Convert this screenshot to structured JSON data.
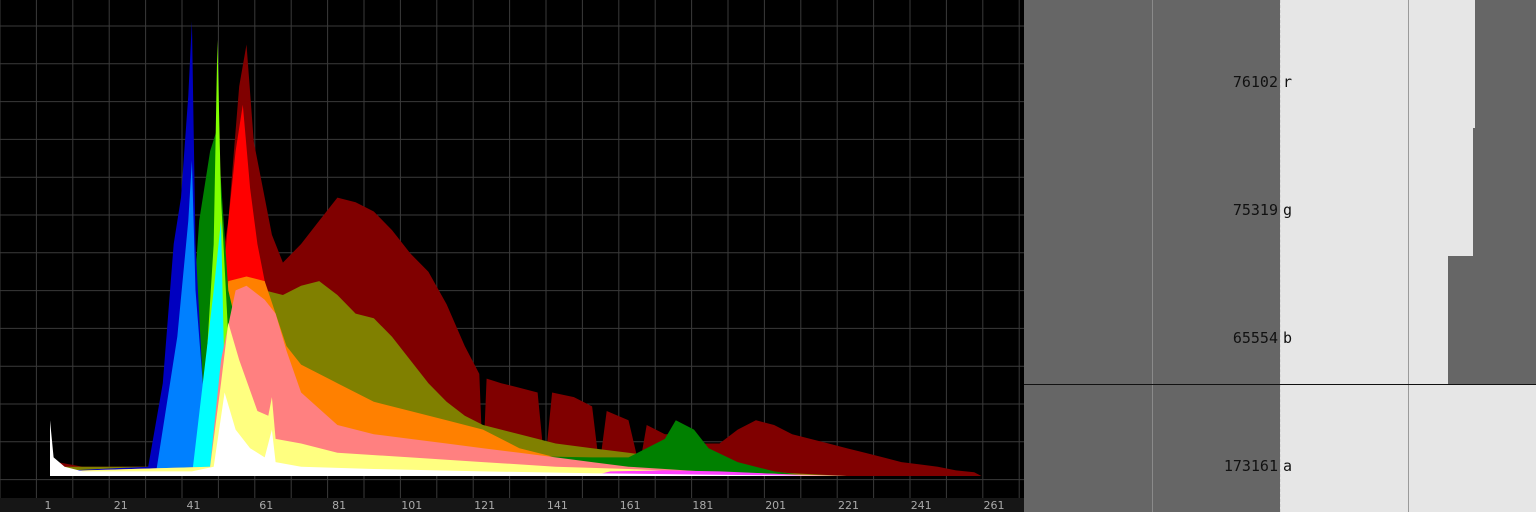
{
  "chart_data": {
    "type": "area",
    "x_ticks": [
      "1",
      "21",
      "41",
      "61",
      "81",
      "101",
      "121",
      "141",
      "161",
      "181",
      "201",
      "221",
      "241",
      "261"
    ],
    "xlim": [
      1,
      261
    ],
    "grid": true,
    "series": [
      {
        "color": "#800000",
        "points": [
          [
            1,
            0.05
          ],
          [
            3,
            0.03
          ],
          [
            10,
            0.02
          ],
          [
            20,
            0.02
          ],
          [
            30,
            0.02
          ],
          [
            40,
            0.1
          ],
          [
            45,
            0.3
          ],
          [
            50,
            0.55
          ],
          [
            53,
            0.84
          ],
          [
            55,
            0.93
          ],
          [
            57,
            0.72
          ],
          [
            60,
            0.6
          ],
          [
            62,
            0.52
          ],
          [
            65,
            0.46
          ],
          [
            70,
            0.5
          ],
          [
            75,
            0.55
          ],
          [
            80,
            0.6
          ],
          [
            85,
            0.59
          ],
          [
            90,
            0.57
          ],
          [
            95,
            0.53
          ],
          [
            100,
            0.48
          ],
          [
            105,
            0.44
          ],
          [
            110,
            0.37
          ],
          [
            115,
            0.28
          ],
          [
            119,
            0.22
          ],
          [
            120,
            0.02
          ],
          [
            121,
            0.21
          ],
          [
            125,
            0.2
          ],
          [
            130,
            0.19
          ],
          [
            135,
            0.18
          ],
          [
            137,
            0.02
          ],
          [
            139,
            0.18
          ],
          [
            145,
            0.17
          ],
          [
            150,
            0.15
          ],
          [
            152,
            0.02
          ],
          [
            154,
            0.14
          ],
          [
            160,
            0.12
          ],
          [
            163,
            0.02
          ],
          [
            165,
            0.11
          ],
          [
            170,
            0.09
          ],
          [
            175,
            0.09
          ],
          [
            180,
            0.07
          ],
          [
            185,
            0.07
          ],
          [
            190,
            0.1
          ],
          [
            195,
            0.12
          ],
          [
            200,
            0.11
          ],
          [
            205,
            0.09
          ],
          [
            210,
            0.08
          ],
          [
            215,
            0.07
          ],
          [
            220,
            0.06
          ],
          [
            225,
            0.05
          ],
          [
            230,
            0.04
          ],
          [
            235,
            0.03
          ],
          [
            240,
            0.025
          ],
          [
            245,
            0.02
          ],
          [
            250,
            0.012
          ],
          [
            255,
            0.008
          ],
          [
            257,
            0
          ]
        ]
      },
      {
        "color": "#ff0000",
        "points": [
          [
            40,
            0
          ],
          [
            46,
            0.2
          ],
          [
            50,
            0.55
          ],
          [
            52,
            0.7
          ],
          [
            54,
            0.8
          ],
          [
            56,
            0.62
          ],
          [
            58,
            0.5
          ],
          [
            60,
            0.42
          ],
          [
            61,
            0
          ]
        ]
      },
      {
        "color": "#808000",
        "points": [
          [
            1,
            0.02
          ],
          [
            40,
            0.02
          ],
          [
            50,
            0.35
          ],
          [
            55,
            0.42
          ],
          [
            60,
            0.4
          ],
          [
            65,
            0.39
          ],
          [
            70,
            0.41
          ],
          [
            75,
            0.42
          ],
          [
            80,
            0.39
          ],
          [
            85,
            0.35
          ],
          [
            90,
            0.34
          ],
          [
            95,
            0.3
          ],
          [
            100,
            0.25
          ],
          [
            105,
            0.2
          ],
          [
            110,
            0.16
          ],
          [
            115,
            0.13
          ],
          [
            120,
            0.11
          ],
          [
            125,
            0.1
          ],
          [
            130,
            0.09
          ],
          [
            140,
            0.07
          ],
          [
            150,
            0.06
          ],
          [
            160,
            0.05
          ],
          [
            170,
            0.04
          ],
          [
            180,
            0.025
          ],
          [
            190,
            0.015
          ],
          [
            200,
            0.008
          ],
          [
            210,
            0.004
          ],
          [
            220,
            0
          ]
        ]
      },
      {
        "color": "#ff8000",
        "points": [
          [
            1,
            0.01
          ],
          [
            45,
            0.02
          ],
          [
            50,
            0.42
          ],
          [
            55,
            0.43
          ],
          [
            60,
            0.42
          ],
          [
            63,
            0.35
          ],
          [
            66,
            0.28
          ],
          [
            70,
            0.24
          ],
          [
            80,
            0.2
          ],
          [
            90,
            0.16
          ],
          [
            100,
            0.14
          ],
          [
            110,
            0.12
          ],
          [
            120,
            0.1
          ],
          [
            130,
            0.06
          ],
          [
            140,
            0.04
          ],
          [
            150,
            0.03
          ],
          [
            160,
            0
          ]
        ]
      },
      {
        "color": "#008000",
        "points": [
          [
            1,
            0.01
          ],
          [
            30,
            0.02
          ],
          [
            38,
            0.1
          ],
          [
            42,
            0.55
          ],
          [
            45,
            0.7
          ],
          [
            47,
            0.75
          ],
          [
            50,
            0.4
          ],
          [
            53,
            0.3
          ],
          [
            60,
            0.1
          ],
          [
            80,
            0.05
          ],
          [
            150,
            0.04
          ],
          [
            160,
            0.04
          ],
          [
            170,
            0.08
          ],
          [
            173,
            0.12
          ],
          [
            178,
            0.1
          ],
          [
            182,
            0.06
          ],
          [
            190,
            0.03
          ],
          [
            200,
            0.01
          ],
          [
            210,
            0
          ]
        ]
      },
      {
        "color": "#0000c0",
        "points": [
          [
            1,
            0.01
          ],
          [
            28,
            0.02
          ],
          [
            32,
            0.2
          ],
          [
            35,
            0.5
          ],
          [
            37,
            0.6
          ],
          [
            39,
            0.82
          ],
          [
            40,
            0.98
          ],
          [
            41,
            0.5
          ],
          [
            43,
            0.2
          ],
          [
            46,
            0.1
          ],
          [
            55,
            0.03
          ],
          [
            80,
            0.01
          ],
          [
            100,
            0
          ]
        ]
      },
      {
        "color": "#0080ff",
        "points": [
          [
            30,
            0
          ],
          [
            36,
            0.3
          ],
          [
            39,
            0.55
          ],
          [
            40,
            0.68
          ],
          [
            41,
            0.4
          ],
          [
            43,
            0.2
          ],
          [
            46,
            0.08
          ],
          [
            50,
            0
          ]
        ]
      },
      {
        "color": "#80ff00",
        "points": [
          [
            42,
            0
          ],
          [
            46,
            0.5
          ],
          [
            47,
            0.94
          ],
          [
            48,
            0.6
          ],
          [
            50,
            0.3
          ],
          [
            53,
            0.1
          ],
          [
            56,
            0
          ]
        ]
      },
      {
        "color": "#00ffff",
        "points": [
          [
            40,
            0
          ],
          [
            43,
            0.2
          ],
          [
            46,
            0.4
          ],
          [
            48,
            0.55
          ],
          [
            49,
            0.2
          ],
          [
            51,
            0.05
          ],
          [
            54,
            0
          ]
        ]
      },
      {
        "color": "#ff8080",
        "points": [
          [
            1,
            0.01
          ],
          [
            45,
            0.02
          ],
          [
            48,
            0.25
          ],
          [
            52,
            0.4
          ],
          [
            55,
            0.41
          ],
          [
            60,
            0.38
          ],
          [
            63,
            0.35
          ],
          [
            66,
            0.27
          ],
          [
            70,
            0.18
          ],
          [
            80,
            0.11
          ],
          [
            90,
            0.09
          ],
          [
            100,
            0.08
          ],
          [
            110,
            0.07
          ],
          [
            120,
            0.06
          ],
          [
            130,
            0.05
          ],
          [
            140,
            0.04
          ],
          [
            150,
            0.03
          ],
          [
            160,
            0.02
          ],
          [
            170,
            0.015
          ],
          [
            180,
            0.01
          ],
          [
            200,
            0.005
          ],
          [
            220,
            0
          ]
        ]
      },
      {
        "color": "#ffff80",
        "points": [
          [
            1,
            0.01
          ],
          [
            45,
            0.02
          ],
          [
            48,
            0.2
          ],
          [
            50,
            0.33
          ],
          [
            53,
            0.25
          ],
          [
            58,
            0.14
          ],
          [
            61,
            0.13
          ],
          [
            62,
            0.17
          ],
          [
            63,
            0.08
          ],
          [
            70,
            0.07
          ],
          [
            80,
            0.05
          ],
          [
            100,
            0.04
          ],
          [
            120,
            0.03
          ],
          [
            140,
            0.02
          ],
          [
            160,
            0.015
          ],
          [
            180,
            0.008
          ],
          [
            200,
            0
          ]
        ]
      },
      {
        "color": "#ff40ff",
        "points": [
          [
            150,
            0
          ],
          [
            155,
            0.01
          ],
          [
            170,
            0.012
          ],
          [
            185,
            0.01
          ],
          [
            200,
            0.005
          ],
          [
            210,
            0
          ]
        ]
      },
      {
        "color": "#ffffff",
        "points": [
          [
            1,
            0.12
          ],
          [
            2,
            0.04
          ],
          [
            5,
            0.02
          ],
          [
            10,
            0.01
          ],
          [
            40,
            0.01
          ],
          [
            46,
            0.02
          ],
          [
            49,
            0.18
          ],
          [
            52,
            0.1
          ],
          [
            56,
            0.06
          ],
          [
            60,
            0.04
          ],
          [
            62,
            0.1
          ],
          [
            63,
            0.03
          ],
          [
            70,
            0.02
          ],
          [
            90,
            0.015
          ],
          [
            120,
            0.01
          ],
          [
            150,
            0.006
          ],
          [
            180,
            0.003
          ],
          [
            220,
            0
          ]
        ]
      }
    ]
  },
  "stats": [
    {
      "count": "76102",
      "label": "r",
      "fraction": 0.76
    },
    {
      "count": "75319",
      "label": "g",
      "fraction": 0.752
    },
    {
      "count": "65554",
      "label": "b",
      "fraction": 0.655
    },
    {
      "count": "173161",
      "label": "a",
      "fraction": 1.0
    }
  ],
  "colors": {
    "background": "#000000",
    "grid": "#3a3a3a",
    "stats_background": "#666666",
    "stats_bar": "#e6e6e6"
  }
}
